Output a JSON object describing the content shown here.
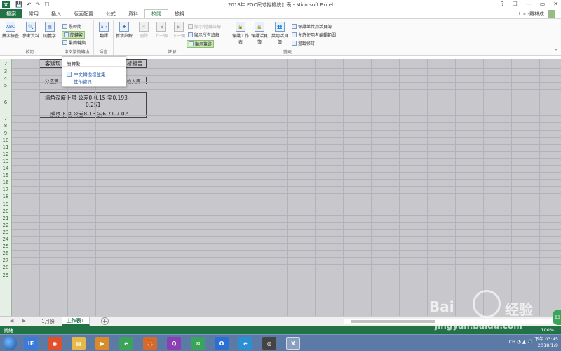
{
  "window": {
    "title": "2018年 FOC尺寸抽檢統計表 - Microsoft Excel",
    "app_logo": "X",
    "qat": [
      "💾",
      "↶",
      "↷",
      "☐"
    ],
    "controls": [
      "?",
      "☐",
      "—",
      "▭",
      "✕"
    ]
  },
  "tabs": {
    "items": [
      "檔案",
      "常用",
      "插入",
      "版面配置",
      "公式",
      "資料",
      "校閱",
      "檢視"
    ],
    "active": "校閱",
    "user": "Luo-羅林成"
  },
  "ribbon": {
    "proofing": {
      "label": "校訂",
      "buttons": [
        "拼字檢查",
        "參考資料",
        "同義字"
      ]
    },
    "chinese_conversion": {
      "label": "中文繁簡轉換",
      "items": [
        "繁轉簡",
        "簡轉繁",
        "繁簡轉換"
      ]
    },
    "language": {
      "label": "語言",
      "button": "翻譯"
    },
    "comments": {
      "label": "註解",
      "buttons": [
        "新增註解",
        "刪除",
        "上一個",
        "下一個"
      ],
      "small": [
        "顯示/隱藏註解",
        "顯示所有註解",
        "顯示筆跡"
      ]
    },
    "changes": {
      "label": "變更",
      "buttons": [
        "保護工作表",
        "保護活頁簿",
        "共用活頁簿"
      ],
      "small": [
        "保護並共用活頁簿",
        "允許使用者編輯範圍",
        "追蹤修訂"
      ]
    }
  },
  "menu": {
    "header": "簡轉繁",
    "items": [
      "中文轉換增益集",
      "其他資訊"
    ]
  },
  "sheet": {
    "rows": [
      "2",
      "3",
      "4",
      "5",
      "6",
      "7",
      "8",
      "9",
      "10",
      "11",
      "12",
      "13",
      "14",
      "15",
      "16",
      "17",
      "18",
      "19",
      "20",
      "21",
      "22",
      "23",
      "24",
      "25",
      "26",
      "27",
      "28",
      "29"
    ],
    "cells": {
      "r2_left": "客诉现",
      "r2_right": "析报告",
      "r4_left": "分选滴",
      "r4_right": "检入库",
      "r6_line1": "墙角深度上限 公差0-0.15  实0.193-",
      "r6_line2": "0.251",
      "r6_line3": "膜厚下限 公差8-13  实6.71-7.02"
    }
  },
  "sheet_tabs": {
    "items": [
      "1月份",
      "工作表1"
    ],
    "active": "工作表1",
    "nav": [
      "◀",
      "▶"
    ],
    "add": "+"
  },
  "status": {
    "ready": "就緒",
    "zoom": "100%"
  },
  "taskbar": {
    "apps": [
      "IE",
      "◉",
      "▤",
      "▶",
      "e",
      "🦊",
      "Q",
      "✉",
      "O",
      "e",
      "◎",
      "X"
    ],
    "tray": "CH ◔ ▲ 🔊",
    "time": "下午 03:45",
    "date": "2018/1/9"
  },
  "watermark": {
    "brand1": "Bai",
    "brand2": "经验",
    "url": "jingyan.baidu.com"
  },
  "side_bubble": "83"
}
